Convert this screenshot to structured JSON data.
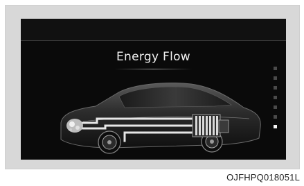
{
  "screen": {
    "title": "Energy Flow",
    "pager": {
      "page_count": 7,
      "active_index": 6
    }
  },
  "figure_code": "OJFHPQ018051L",
  "icons": {
    "vehicle": "hybrid-car-energy-flow-icon",
    "battery": "battery-pack-icon",
    "engine": "engine-icon"
  },
  "colors": {
    "screen_bg": "#0a0a0a",
    "frame_bg": "#d8d8d8",
    "text": "#f2f2f2",
    "flow_line": "#e6e6e6"
  }
}
